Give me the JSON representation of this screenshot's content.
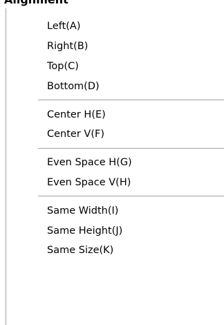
{
  "parent_menu": {
    "label": "Alignment"
  },
  "menu": {
    "groups": [
      {
        "items": [
          {
            "label": "Left(A)"
          },
          {
            "label": "Right(B)"
          },
          {
            "label": "Top(C)"
          },
          {
            "label": "Bottom(D)"
          }
        ]
      },
      {
        "items": [
          {
            "label": "Center H(E)"
          },
          {
            "label": "Center V(F)"
          }
        ]
      },
      {
        "items": [
          {
            "label": "Even Space H(G)"
          },
          {
            "label": "Even Space V(H)"
          }
        ]
      },
      {
        "items": [
          {
            "label": "Same Width(I)"
          },
          {
            "label": "Same Height(J)"
          },
          {
            "label": "Same Size(K)"
          }
        ]
      }
    ]
  }
}
